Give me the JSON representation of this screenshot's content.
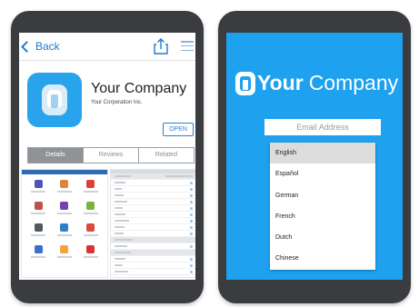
{
  "left_device": {
    "nav": {
      "back_label": "Back",
      "share_icon": "share-icon",
      "menu_icon": "list-menu-icon"
    },
    "app": {
      "name": "Your Company",
      "publisher": "Your Corporation Inc.",
      "open_label": "OPEN",
      "icon": "app-logo-icon",
      "icon_color": "#29a3ec"
    },
    "tabs": [
      {
        "label": "Details",
        "active": true
      },
      {
        "label": "Reviews",
        "active": false
      },
      {
        "label": "Related",
        "active": false
      }
    ],
    "screenshots": [
      "dashboard-icon-grid-preview",
      "settings-list-preview"
    ]
  },
  "right_device": {
    "brand": {
      "bold": "Your",
      "light": "Company"
    },
    "email_placeholder": "Email Address",
    "languages": [
      "English",
      "Español",
      "German",
      "French",
      "Dutch",
      "Chinese"
    ],
    "selected_language": "English",
    "background_color": "#1ea1ef"
  }
}
